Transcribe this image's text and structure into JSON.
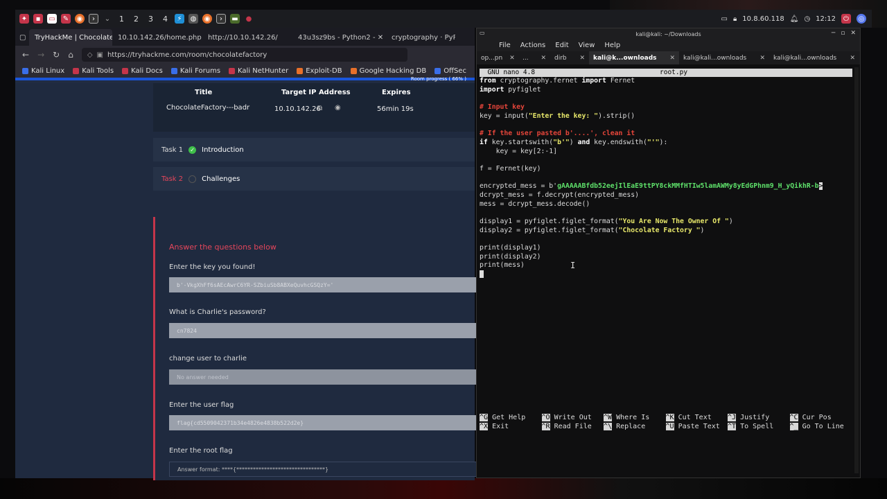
{
  "panel": {
    "workspaces": [
      "1",
      "2",
      "3",
      "4"
    ],
    "ip": "10.8.60.118",
    "clock": "12:12"
  },
  "browser": {
    "tabs": [
      "TryHackMe | Chocolate",
      "10.10.142.26/home.php",
      "http://10.10.142.26/",
      "43u3sz9bs - Python2 -",
      "cryptography · PyPI"
    ],
    "url": "https://tryhackme.com/room/chocolatefactory",
    "bookmarks": [
      "Kali Linux",
      "Kali Tools",
      "Kali Docs",
      "Kali Forums",
      "Kali NetHunter",
      "Exploit-DB",
      "Google Hacking DB",
      "OffSec"
    ],
    "progress_label": "Room progress ( 66% )",
    "progress": 66,
    "info": {
      "h_title": "Title",
      "h_ip": "Target IP Address",
      "h_expires": "Expires",
      "title": "ChocolateFactory---badr",
      "ip": "10.10.142.26",
      "expires": "56min 19s"
    },
    "tasks": [
      {
        "num": "Task 1",
        "title": "Introduction"
      },
      {
        "num": "Task 2",
        "title": "Challenges"
      }
    ],
    "questions": {
      "heading": "Answer the questions below",
      "q1": "Enter the key you found!",
      "a1": "b'-VkgXhFf6sAEcAwrC6YR-SZbiuSb8ABXeQuvhcGSQzY='",
      "q2": "What is Charlie's password?",
      "a2": "cn7824",
      "q3": "change user to charlie",
      "a3": "No answer needed",
      "q4": "Enter the user flag",
      "a4": "flag{cd5509042371b34e4826e4838b522d2e}",
      "q5": "Enter the root flag",
      "a5": "Answer format: ****{********************************}"
    }
  },
  "terminal": {
    "title": "kali@kali: ~/Downloads",
    "menu": [
      "File",
      "Actions",
      "Edit",
      "View",
      "Help"
    ],
    "tabs": [
      "op...pn",
      "...",
      "dirb",
      "kali@k...ownloads",
      "kali@kali...ownloads",
      "kali@kali...ownloads"
    ],
    "nano_version": "  GNU nano 4.8",
    "filename": "root.py",
    "code": {
      "l1a": "from",
      "l1b": " cryptography.fernet ",
      "l1c": "import",
      "l1d": " Fernet",
      "l2a": "import",
      "l2b": " pyfiglet",
      "l4": "# Input key",
      "l5a": "key = input(",
      "l5b": "\"Enter the key: \"",
      "l5c": ").strip()",
      "l7": "# If the user pasted b'....', clean it",
      "l8a": "if",
      "l8b": " key.startswith(",
      "l8c": "\"b'\"",
      "l8d": ") ",
      "l8e": "and",
      "l8f": " key.endswith(",
      "l8g": "\"'\"",
      "l8h": "):",
      "l9": "    key = key[2:-1]",
      "l11": "f = Fernet(key)",
      "l13a": "encrypted_mess = b'",
      "l13b": "gAAAAABfdb52eejIlEaE9ttPY8ckMMfHTIw5lamAWMy8yEdGPhnm9_H_yQikhR-b",
      "l14": "dcrypt_mess = f.decrypt(encrypted_mess)",
      "l15": "mess = dcrypt_mess.decode()",
      "l17a": "display1 = pyfiglet.figlet_format(",
      "l17b": "\"You Are Now The Owner Of \"",
      "l17c": ")",
      "l18a": "display2 = pyfiglet.figlet_format(",
      "l18b": "\"Chocolate Factory \"",
      "l18c": ")",
      "l20": "print(display1)",
      "l21": "print(display2)",
      "l22": "print(mess)"
    },
    "help": [
      [
        "^G",
        "Get Help"
      ],
      [
        "^O",
        "Write Out"
      ],
      [
        "^W",
        "Where Is"
      ],
      [
        "^K",
        "Cut Text"
      ],
      [
        "^J",
        "Justify"
      ],
      [
        "^C",
        "Cur Pos"
      ],
      [
        "^X",
        "Exit"
      ],
      [
        "^R",
        "Read File"
      ],
      [
        "^\\",
        "Replace"
      ],
      [
        "^U",
        "Paste Text"
      ],
      [
        "^T",
        "To Spell"
      ],
      [
        "^_",
        "Go To Line"
      ]
    ]
  }
}
